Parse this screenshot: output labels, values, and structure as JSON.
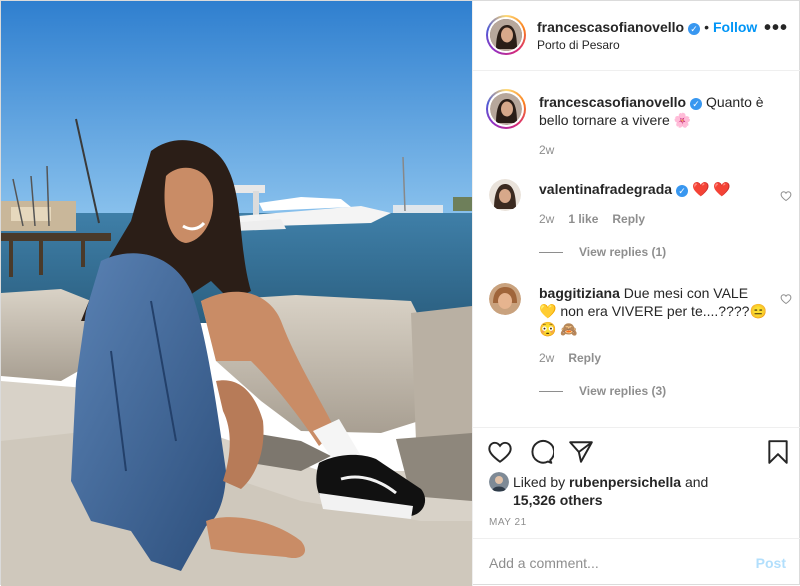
{
  "header": {
    "username": "francescasofianovello",
    "separator": "•",
    "follow_label": "Follow",
    "location": "Porto di Pesaro",
    "more_label": "•••"
  },
  "caption": {
    "username": "francescasofianovello",
    "text": "Quanto è bello tornare a vivere",
    "emoji": "🌸",
    "age": "2w"
  },
  "comments": [
    {
      "username": "valentinafradegrada",
      "verified": true,
      "text": "❤️ ❤️",
      "age": "2w",
      "likes": "1 like",
      "reply_label": "Reply",
      "view_replies": "View replies (1)"
    },
    {
      "username": "baggitiziana",
      "verified": false,
      "text_line1": "Due mesi con VALE",
      "text_line2": "💛  non era VIVERE per te....????😑",
      "text_line3": "😳 🙈",
      "age": "2w",
      "reply_label": "Reply",
      "view_replies": "View replies (3)"
    }
  ],
  "actions": {
    "icons": [
      "heart-icon",
      "comment-icon",
      "share-icon",
      "bookmark-icon"
    ],
    "liked_by_prefix": "Liked by",
    "liked_by_user": "rubenpersichella",
    "liked_by_and": "and",
    "others": "15,326 others",
    "date": "MAY 21"
  },
  "add_comment": {
    "placeholder": "Add a comment...",
    "post_label": "Post"
  },
  "colors": {
    "accent": "#0095f6",
    "verified": "#3897f0",
    "muted": "#8e8e8e",
    "post_disabled": "#b2dffc"
  }
}
